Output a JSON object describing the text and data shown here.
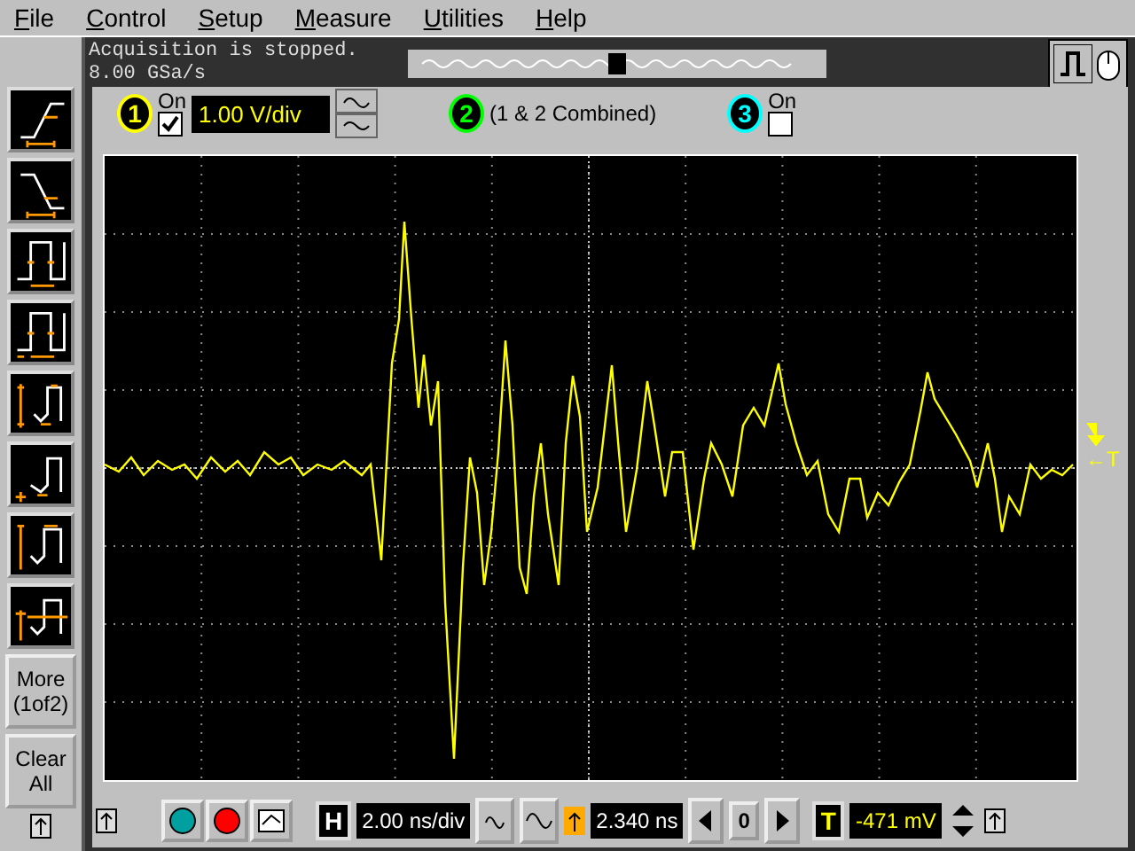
{
  "menu": [
    {
      "label": "File"
    },
    {
      "label": "Control"
    },
    {
      "label": "Setup"
    },
    {
      "label": "Measure"
    },
    {
      "label": "Utilities"
    },
    {
      "label": "Help"
    }
  ],
  "status": {
    "message": "Acquisition is stopped.",
    "sample_rate": "8.00 GSa/s"
  },
  "channels": [
    {
      "number": "1",
      "color": "#ffff00",
      "on_label": "On",
      "checked": true,
      "scale": "1.00 V/div"
    },
    {
      "number": "2",
      "color": "#00ff00",
      "label": "(1 & 2 Combined)"
    },
    {
      "number": "3",
      "color": "#00ffff",
      "on_label": "On",
      "checked": false
    }
  ],
  "measure_tools": [
    {
      "kind": "rise"
    },
    {
      "kind": "fall"
    },
    {
      "kind": "period"
    },
    {
      "kind": "frequency"
    },
    {
      "kind": "amplitude"
    },
    {
      "kind": "base"
    },
    {
      "kind": "max"
    },
    {
      "kind": "average"
    }
  ],
  "side_buttons": [
    "More (1of2)",
    "Clear All"
  ],
  "trigger_marker": "←T",
  "horizontal": {
    "label": "H",
    "scale": "2.00 ns/div",
    "delay": "2.340 ns",
    "zero": "0"
  },
  "trigger": {
    "label": "T",
    "level": "-471 mV"
  }
}
